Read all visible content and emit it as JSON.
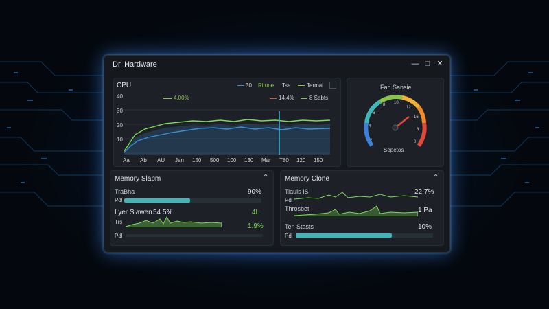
{
  "window": {
    "title": "Dr. Hardware",
    "controls": [
      "minimize-icon",
      "maximize-icon",
      "close-icon"
    ]
  },
  "cpu": {
    "title": "CPU",
    "y_ticks": [
      "40",
      "30",
      "20",
      "10"
    ],
    "x_ticks": [
      "Aa",
      "Ab",
      "AU",
      "Jan",
      "150",
      "500",
      "100",
      "130",
      "Mar",
      "T80",
      "120",
      "150"
    ],
    "annotation_top": "4.00%",
    "annotation_mid": "14.4%",
    "annotation_right": "8 Sabts",
    "legend": [
      {
        "label": "30",
        "color": "#3b8fd6"
      },
      {
        "label": "Ritune",
        "color": "#8bc34a"
      },
      {
        "label": "Tse",
        "color": "#9aa3ad"
      },
      {
        "label": "Termal",
        "color": "#8bc34a"
      }
    ]
  },
  "fan": {
    "title": "Fan Sansie",
    "scale": [
      "2",
      "4",
      "6",
      "8",
      "10",
      "12",
      "16",
      "8",
      "0"
    ],
    "bottom_label": "Sepetos"
  },
  "memory_left": {
    "title": "Memory Slapm",
    "row1_label": "TraBha",
    "row1_value": "90%",
    "row1_sub": "Pdl",
    "row1_fill": 0.48,
    "row2_label": "Lyer Slawen",
    "row2_pct": "54 5%",
    "row2_value": "4L",
    "row3_label": "Trs",
    "row3_value": "1.9%",
    "row3_sub": "Pdl"
  },
  "memory_right": {
    "title": "Memory Clone",
    "row1_label": "Tiauls IS",
    "row1_value": "22.7%",
    "row1_sub": "Pdl",
    "row2_label": "Throsbet",
    "row2_value": "1 Pa",
    "row3_label": "Ten Stasts",
    "row3_value": "10%",
    "row3_sub": "Pdl",
    "row3_fill": 0.7
  },
  "colors": {
    "accent_blue": "#3b8fd6",
    "accent_green": "#7ed957",
    "accent_teal": "#3fb6b7"
  }
}
